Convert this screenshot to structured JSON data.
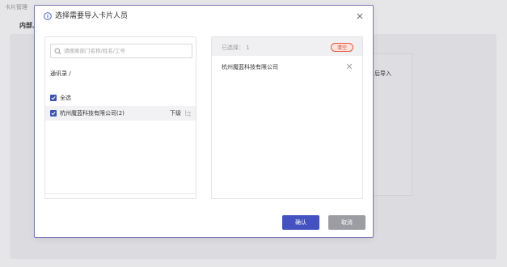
{
  "background": {
    "breadcrumb": "卡片管理",
    "tab_label": "内部人",
    "side_text": "后导入"
  },
  "modal": {
    "title": "选择需要导入卡片人员",
    "search": {
      "placeholder": "请搜索部门名称/姓名/工号",
      "value": ""
    },
    "breadcrumb": "通讯录 /",
    "select_all_label": "全选",
    "org_item": {
      "label": "杭州魔蓝科技有限公司(2)",
      "sub_label": "下级",
      "checked": true
    },
    "selected": {
      "count_text": "已选择： 1",
      "clear_label": "清空",
      "items": [
        "杭州魔蓝科技有限公司"
      ]
    },
    "confirm_label": "确认",
    "cancel_label": "取消"
  },
  "colors": {
    "primary": "#4352c0",
    "clear_border": "#e8553c",
    "cancel": "#9c9ca3"
  }
}
